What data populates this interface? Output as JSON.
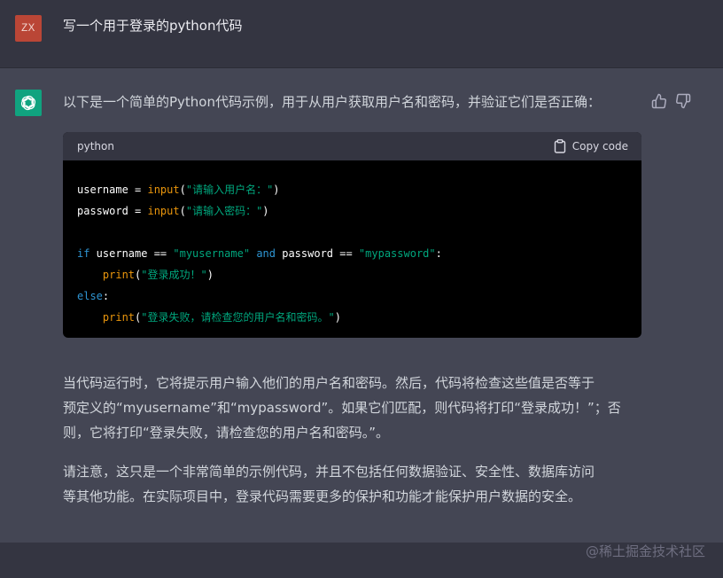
{
  "user_message": {
    "avatar_initials": "ZX",
    "text": "写一个用于登录的python代码"
  },
  "assistant_message": {
    "intro": "以下是一个简单的Python代码示例，用于从用户获取用户名和密码，并验证它们是否正确：",
    "code_block": {
      "language": "python",
      "copy_label": "Copy code",
      "lines": [
        [
          "username",
          " = ",
          "input",
          "(",
          "\"请输入用户名：\"",
          ")"
        ],
        [
          "password",
          " = ",
          "input",
          "(",
          "\"请输入密码：\"",
          ")"
        ]
      ],
      "if_line": {
        "kw_if": "if",
        "var1": " username ",
        "op1": "==",
        "str1": " \"myusername\" ",
        "kw_and": "and",
        "var2": " password ",
        "op2": "==",
        "str2": " \"mypassword\"",
        "colon": ":"
      },
      "print_success": {
        "indent": "    ",
        "fn": "print",
        "open": "(",
        "str": "\"登录成功！\"",
        "close": ")"
      },
      "else_line": {
        "kw": "else",
        "colon": ":"
      },
      "print_fail": {
        "indent": "    ",
        "fn": "print",
        "open": "(",
        "str": "\"登录失败，请检查您的用户名和密码。\"",
        "close": ")"
      }
    },
    "paragraph1_lines": [
      "当代码运行时，它将提示用户输入他们的用户名和密码。然后，代码将检查这些值是否等于",
      "预定义的“myusername”和“mypassword”。如果它们匹配，则代码将打印“登录成功！”；否",
      "则，它将打印“登录失败，请检查您的用户名和密码。”。"
    ],
    "paragraph2_lines": [
      "请注意，这只是一个非常简单的示例代码，并且不包括任何数据验证、安全性、数据库访问",
      "等其他功能。在实际项目中，登录代码需要更多的保护和功能才能保护用户数据的安全。"
    ]
  },
  "watermark": "@稀土掘金技术社区",
  "icons": {
    "assistant_avatar": "openai-logo-icon",
    "copy": "clipboard-icon",
    "thumbs_up": "thumbs-up-icon",
    "thumbs_down": "thumbs-down-icon"
  },
  "colors": {
    "background": "#343541",
    "assistant_background": "#444654",
    "user_avatar": "#ba4636",
    "assistant_avatar": "#10a37f",
    "code_keyword": "#2e95d3",
    "code_function": "#e9950c",
    "code_string": "#00a67d"
  }
}
